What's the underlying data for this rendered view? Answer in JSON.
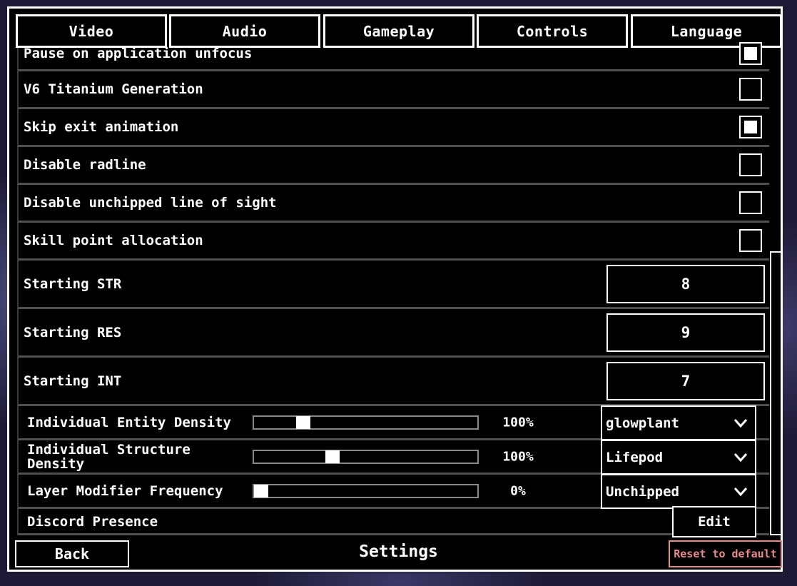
{
  "tabs": [
    {
      "label": "Video"
    },
    {
      "label": "Audio"
    },
    {
      "label": "Gameplay"
    },
    {
      "label": "Controls"
    },
    {
      "label": "Language"
    }
  ],
  "rows": {
    "pause": {
      "label": "Pause on application unfocus",
      "checked": true
    },
    "titanium": {
      "label": "V6 Titanium Generation",
      "checked": false
    },
    "skip_exit": {
      "label": "Skip exit animation",
      "checked": true
    },
    "radline": {
      "label": "Disable radline",
      "checked": false
    },
    "los": {
      "label": "Disable unchipped line of sight",
      "checked": false
    },
    "skill": {
      "label": "Skill point allocation",
      "checked": false
    },
    "str": {
      "label": "Starting STR",
      "value": "8"
    },
    "res": {
      "label": "Starting RES",
      "value": "9"
    },
    "int": {
      "label": "Starting INT",
      "value": "7"
    },
    "entity": {
      "label": "Individual Entity Density",
      "percent": "100%",
      "slider": 0.2,
      "option": "glowplant"
    },
    "structure": {
      "label": "Individual Structure Density",
      "percent": "100%",
      "slider": 0.34,
      "option": "Lifepod"
    },
    "layer": {
      "label": "Layer Modifier Frequency",
      "percent": "0%",
      "slider": 0.0,
      "option": "Unchipped"
    },
    "discord": {
      "label": "Discord Presence",
      "button": "Edit"
    }
  },
  "footer": {
    "back": "Back",
    "title": "Settings",
    "reset": "Reset to default"
  },
  "colors": {
    "reset": "#e88a8a",
    "background": "#1c1a34",
    "panel": "#000000",
    "row_separator": "#4f4f4f"
  }
}
